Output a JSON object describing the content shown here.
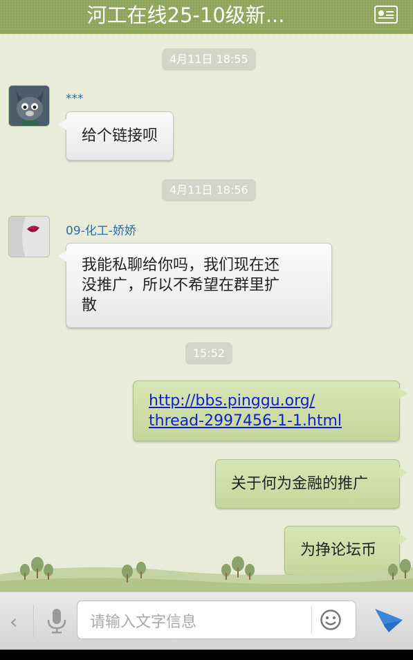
{
  "header": {
    "title": "河工在线25-10级新...",
    "profile_icon": "profile-card-icon",
    "accent": "#8ea65b"
  },
  "messages": [
    {
      "kind": "time",
      "text": "4月11日 18:55"
    },
    {
      "kind": "in",
      "sender": "***",
      "avatar": "wolf-avatar",
      "text": "给个链接呗"
    },
    {
      "kind": "time",
      "text": "4月11日 18:56"
    },
    {
      "kind": "in",
      "sender": "09-化工-娇娇",
      "avatar": "lips-avatar",
      "lines": [
        "我能私聊给你吗，我们现在还",
        "没推广，所以不希望在群里扩",
        "散"
      ]
    },
    {
      "kind": "time",
      "text": "15:52"
    },
    {
      "kind": "out",
      "link_lines": [
        "http://bbs.pinggu.org/",
        "thread-2997456-1-1.html"
      ]
    },
    {
      "kind": "out",
      "text": "关于何为金融的推广"
    },
    {
      "kind": "out",
      "text": "为挣论坛币"
    }
  ],
  "input_bar": {
    "back_icon": "chevron-left-icon",
    "mic_icon": "microphone-icon",
    "placeholder": "请输入文字信息",
    "emoji_icon": "smiley-icon",
    "send_icon": "send-icon",
    "send_color": "#3a86d8"
  }
}
